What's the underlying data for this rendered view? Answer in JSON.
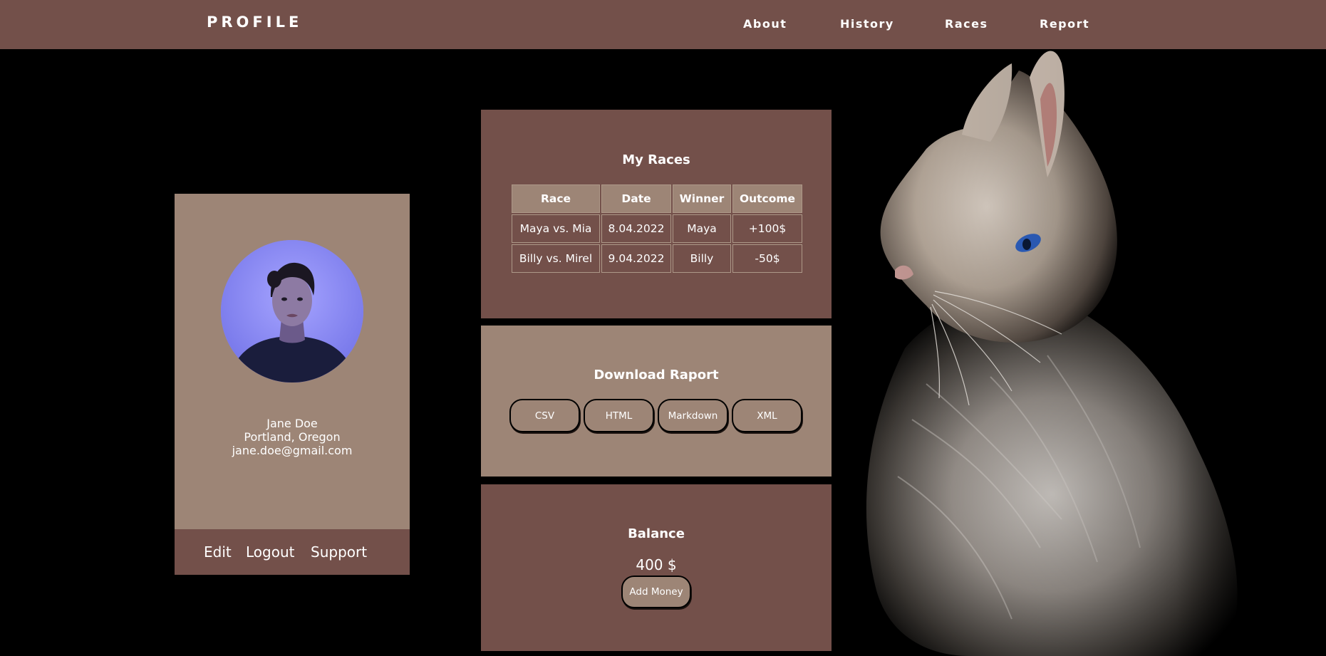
{
  "navbar": {
    "brand": "PROFILE",
    "links": [
      "About",
      "History",
      "Races",
      "Report"
    ]
  },
  "profile": {
    "name": "Jane Doe",
    "location": "Portland, Oregon",
    "email": "jane.doe@gmail.com",
    "actions": [
      "Edit",
      "Logout",
      "Support"
    ]
  },
  "races": {
    "title": "My Races",
    "headers": [
      "Race",
      "Date",
      "Winner",
      "Outcome"
    ],
    "rows": [
      [
        "Maya vs. Mia",
        "8.04.2022",
        "Maya",
        "+100$"
      ],
      [
        "Billy vs. Mirel",
        "9.04.2022",
        "Billy",
        "-50$"
      ]
    ]
  },
  "report": {
    "title": "Download Raport",
    "formats": [
      "CSV",
      "HTML",
      "Markdown",
      "XML"
    ]
  },
  "balance": {
    "title": "Balance",
    "value": "400 $",
    "add_label": "Add Money"
  },
  "colors": {
    "dark_brown": "#73504a",
    "light_brown": "#9d8576",
    "background": "#000000"
  }
}
